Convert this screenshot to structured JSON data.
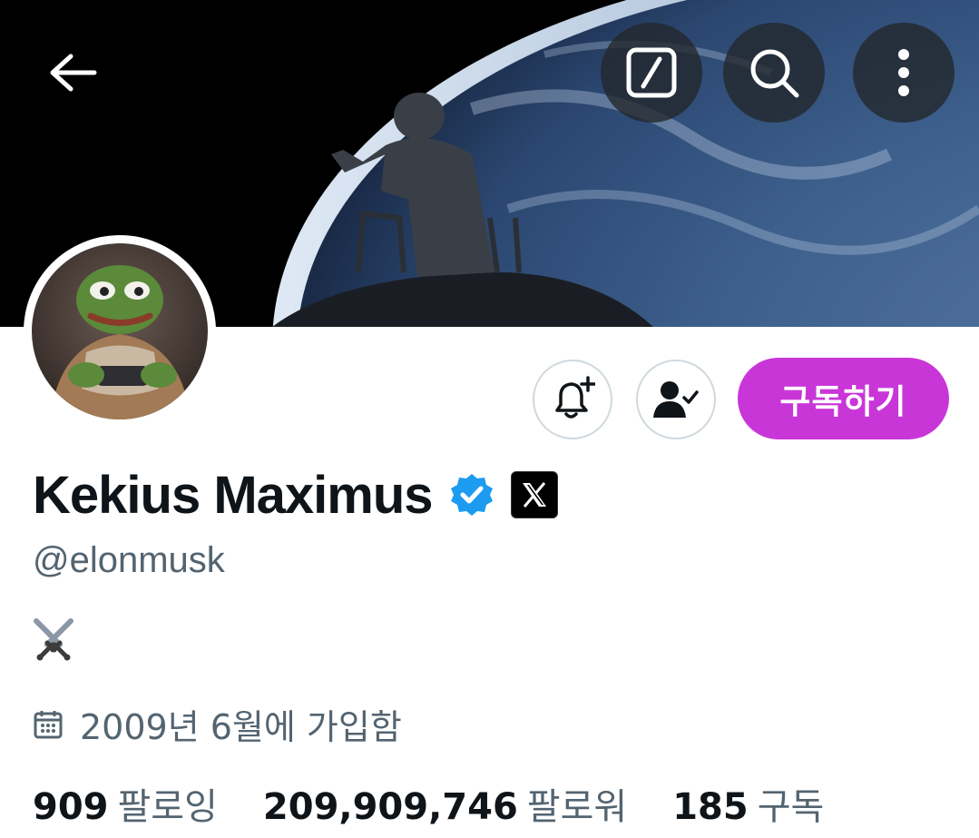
{
  "header": {
    "back_icon": "arrow-left-icon",
    "actions": [
      {
        "name": "edit-square-icon"
      },
      {
        "name": "search-icon"
      },
      {
        "name": "more-vertical-icon"
      }
    ]
  },
  "profile": {
    "display_name": "Kekius Maximus",
    "handle": "@elonmusk",
    "bio_emoji": "crossed-swords",
    "joined": "2009년 6월에 가입함",
    "verified_color": "#1d9bf0"
  },
  "actions": {
    "notify_icon": "bell-plus-icon",
    "following_icon": "person-check-icon",
    "subscribe_label": "구독하기",
    "subscribe_color": "#c936d8"
  },
  "stats": [
    {
      "num": "909",
      "label": "팔로잉"
    },
    {
      "num": "209,909,746",
      "label": "팔로워"
    },
    {
      "num": "185",
      "label": "구독"
    }
  ]
}
